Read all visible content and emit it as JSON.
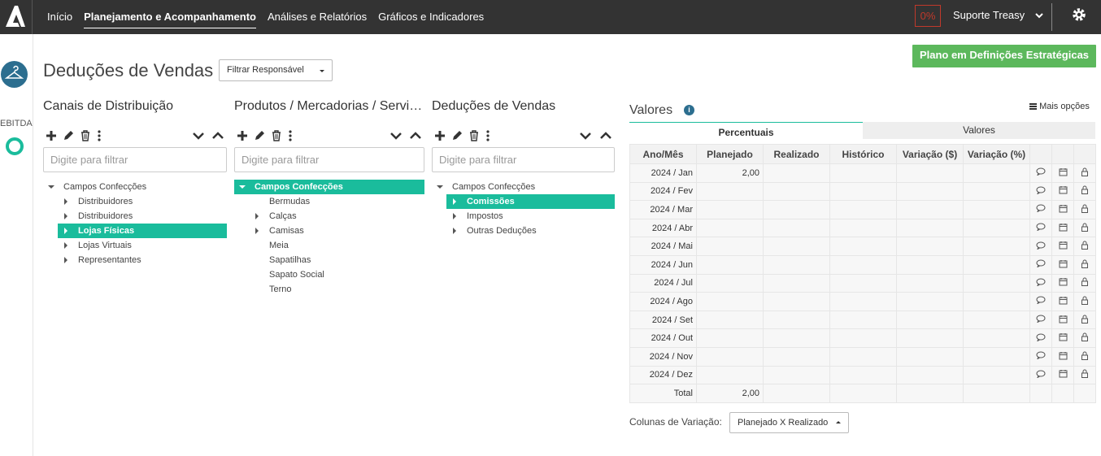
{
  "nav": {
    "items": [
      "Início",
      "Planejamento e Acompanhamento",
      "Análises e Relatórios",
      "Gráficos e Indicadores"
    ],
    "percent": "0%",
    "user": "Suporte Treasy"
  },
  "sidebar": {
    "ebitda_label": "EBITDA"
  },
  "page": {
    "title": "Deduções de Vendas",
    "filter_label": "Filtrar Responsável",
    "plan_button": "Plano em Definições Estratégicas"
  },
  "columns": [
    {
      "title": "Canais de Distribuição",
      "placeholder": "Digite para filtrar",
      "rows": [
        {
          "label": "Campos Confecções",
          "arrow": "down",
          "level": 0,
          "selected": false
        },
        {
          "label": "Distribuidores",
          "arrow": "right",
          "level": 1,
          "selected": false
        },
        {
          "label": "Distribuidores",
          "arrow": "right",
          "level": 1,
          "selected": false
        },
        {
          "label": "Lojas Físicas",
          "arrow": "right",
          "level": 1,
          "selected": true
        },
        {
          "label": "Lojas Virtuais",
          "arrow": "right",
          "level": 1,
          "selected": false
        },
        {
          "label": "Representantes",
          "arrow": "right",
          "level": 1,
          "selected": false
        }
      ]
    },
    {
      "title": "Produtos / Mercadorias / Serviços",
      "placeholder": "Digite para filtrar",
      "rows": [
        {
          "label": "Campos Confecções",
          "arrow": "down",
          "level": 0,
          "selected": true
        },
        {
          "label": "Bermudas",
          "arrow": "none",
          "level": 1,
          "selected": false
        },
        {
          "label": "Calças",
          "arrow": "right",
          "level": 1,
          "selected": false
        },
        {
          "label": "Camisas",
          "arrow": "right",
          "level": 1,
          "selected": false
        },
        {
          "label": "Meia",
          "arrow": "none",
          "level": 1,
          "selected": false
        },
        {
          "label": "Sapatilhas",
          "arrow": "none",
          "level": 1,
          "selected": false
        },
        {
          "label": "Sapato Social",
          "arrow": "none",
          "level": 1,
          "selected": false
        },
        {
          "label": "Terno",
          "arrow": "none",
          "level": 1,
          "selected": false
        }
      ]
    },
    {
      "title": "Deduções de Vendas",
      "placeholder": "Digite para filtrar",
      "rows": [
        {
          "label": "Campos Confecções",
          "arrow": "down",
          "level": 0,
          "selected": false
        },
        {
          "label": "Comissões",
          "arrow": "right",
          "level": 1,
          "selected": true
        },
        {
          "label": "Impostos",
          "arrow": "right",
          "level": 1,
          "selected": false
        },
        {
          "label": "Outras Deduções",
          "arrow": "right",
          "level": 1,
          "selected": false
        }
      ]
    }
  ],
  "valores": {
    "title": "Valores",
    "more_options": "Mais opções",
    "tabs": [
      "Percentuais",
      "Valores"
    ],
    "headers": [
      "Ano/Mês",
      "Planejado",
      "Realizado",
      "Histórico",
      "Variação ($)",
      "Variação (%)"
    ],
    "rows": [
      {
        "mes": "2024 / Jan",
        "planejado": "2,00"
      },
      {
        "mes": "2024 / Fev",
        "planejado": ""
      },
      {
        "mes": "2024 / Mar",
        "planejado": ""
      },
      {
        "mes": "2024 / Abr",
        "planejado": ""
      },
      {
        "mes": "2024 / Mai",
        "planejado": ""
      },
      {
        "mes": "2024 / Jun",
        "planejado": ""
      },
      {
        "mes": "2024 / Jul",
        "planejado": ""
      },
      {
        "mes": "2024 / Ago",
        "planejado": ""
      },
      {
        "mes": "2024 / Set",
        "planejado": ""
      },
      {
        "mes": "2024 / Out",
        "planejado": ""
      },
      {
        "mes": "2024 / Nov",
        "planejado": ""
      },
      {
        "mes": "2024 / Dez",
        "planejado": ""
      }
    ],
    "total_label": "Total",
    "total_planejado": "2,00",
    "variation_label": "Colunas de Variação:",
    "variation_value": "Planejado X Realizado"
  },
  "colors": {
    "accent": "#1abc9c",
    "topbar": "#333333",
    "green_button": "#5cb85c",
    "brand_blue": "#2c6e8f"
  }
}
